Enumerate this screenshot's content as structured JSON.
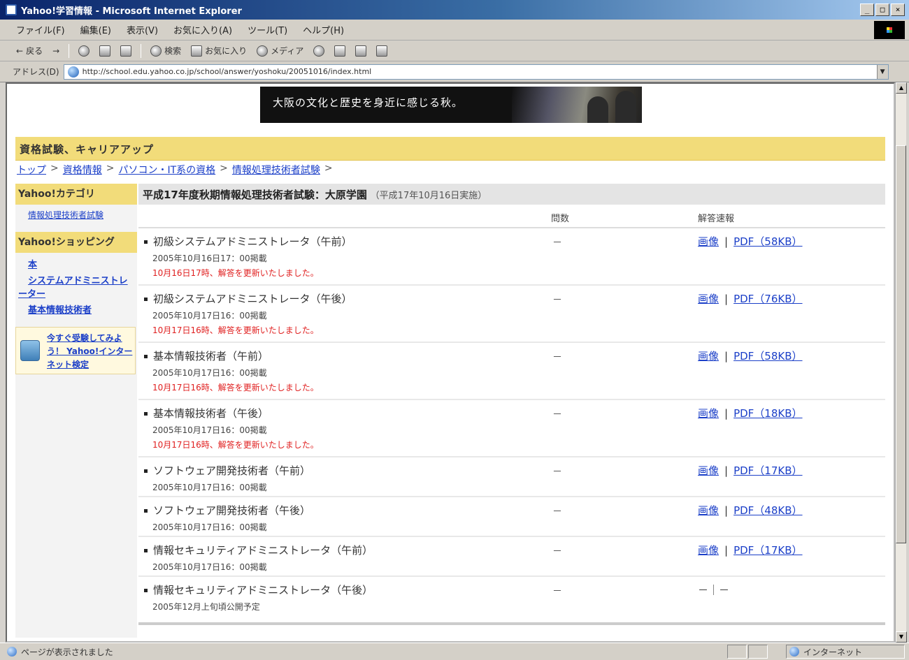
{
  "window": {
    "title": "Yahoo!学習情報 - Microsoft Internet Explorer",
    "minimize": "_",
    "maximize": "□",
    "close": "×"
  },
  "menubar": [
    "ファイル(F)",
    "編集(E)",
    "表示(V)",
    "お気に入り(A)",
    "ツール(T)",
    "ヘルプ(H)"
  ],
  "toolbar": {
    "back": "戻る",
    "search": "検索",
    "favorites": "お気に入り",
    "media": "メディア"
  },
  "address": {
    "label": "アドレス(D)",
    "url": "http://school.edu.yahoo.co.jp/school/answer/yoshoku/20051016/index.html"
  },
  "banner": {
    "text": "大阪の文化と歴史を身近に感じる秋。"
  },
  "page": {
    "section_title": "資格試験、キャリアアップ",
    "breadcrumb": [
      "トップ",
      "資格情報",
      "パソコン・IT系の資格",
      "情報処理技術者試験"
    ]
  },
  "sidebar": {
    "category_heading": "Yahoo!カテゴリ",
    "category_link": "情報処理技術者試験",
    "shopping_heading": "Yahoo!ショッピング",
    "shopping_links": [
      "本",
      "システムアドミニストレーター",
      "基本情報技術者"
    ],
    "promo_text": "今すぐ受験してみよう！ Yahoo!インターネット検定"
  },
  "main": {
    "exam_title": "平成17年度秋期情報処理技術者試験：大原学園",
    "exam_note": "（平成17年10月16日実施）",
    "col_count": "問数",
    "col_answers": "解答速報",
    "answer_link": "画像",
    "pipe": "|",
    "rows": [
      {
        "name": "初級システムアドミニストレータ（午前）",
        "meta": "2005年10月16日17：00掲載",
        "notice": "10月16日17時、解答を更新いたしました。",
        "count": "－",
        "pdf": "PDF（58KB）"
      },
      {
        "name": "初級システムアドミニストレータ（午後）",
        "meta": "2005年10月17日16：00掲載",
        "notice": "10月17日16時、解答を更新いたしました。",
        "count": "－",
        "pdf": "PDF（76KB）"
      },
      {
        "name": "基本情報技術者（午前）",
        "meta": "2005年10月17日16：00掲載",
        "notice": "10月17日16時、解答を更新いたしました。",
        "count": "－",
        "pdf": "PDF（58KB）"
      },
      {
        "name": "基本情報技術者（午後）",
        "meta": "2005年10月17日16：00掲載",
        "notice": "10月17日16時、解答を更新いたしました。",
        "count": "－",
        "pdf": "PDF（18KB）"
      },
      {
        "name": "ソフトウェア開発技術者（午前）",
        "meta": "2005年10月17日16：00掲載",
        "notice": "",
        "count": "－",
        "pdf": "PDF（17KB）"
      },
      {
        "name": "ソフトウェア開発技術者（午後）",
        "meta": "2005年10月17日16：00掲載",
        "notice": "",
        "count": "－",
        "pdf": "PDF（48KB）"
      },
      {
        "name": "情報セキュリティアドミニストレータ（午前）",
        "meta": "2005年10月17日16：00掲載",
        "notice": "",
        "count": "－",
        "pdf": "PDF（17KB）"
      },
      {
        "name": "情報セキュリティアドミニストレータ（午後）",
        "meta": "2005年12月上旬頃公開予定",
        "notice": "",
        "count": "－",
        "answers_text": "－｜－"
      }
    ]
  },
  "status": {
    "left_text": "ページが表示されました",
    "zone": "インターネット"
  }
}
